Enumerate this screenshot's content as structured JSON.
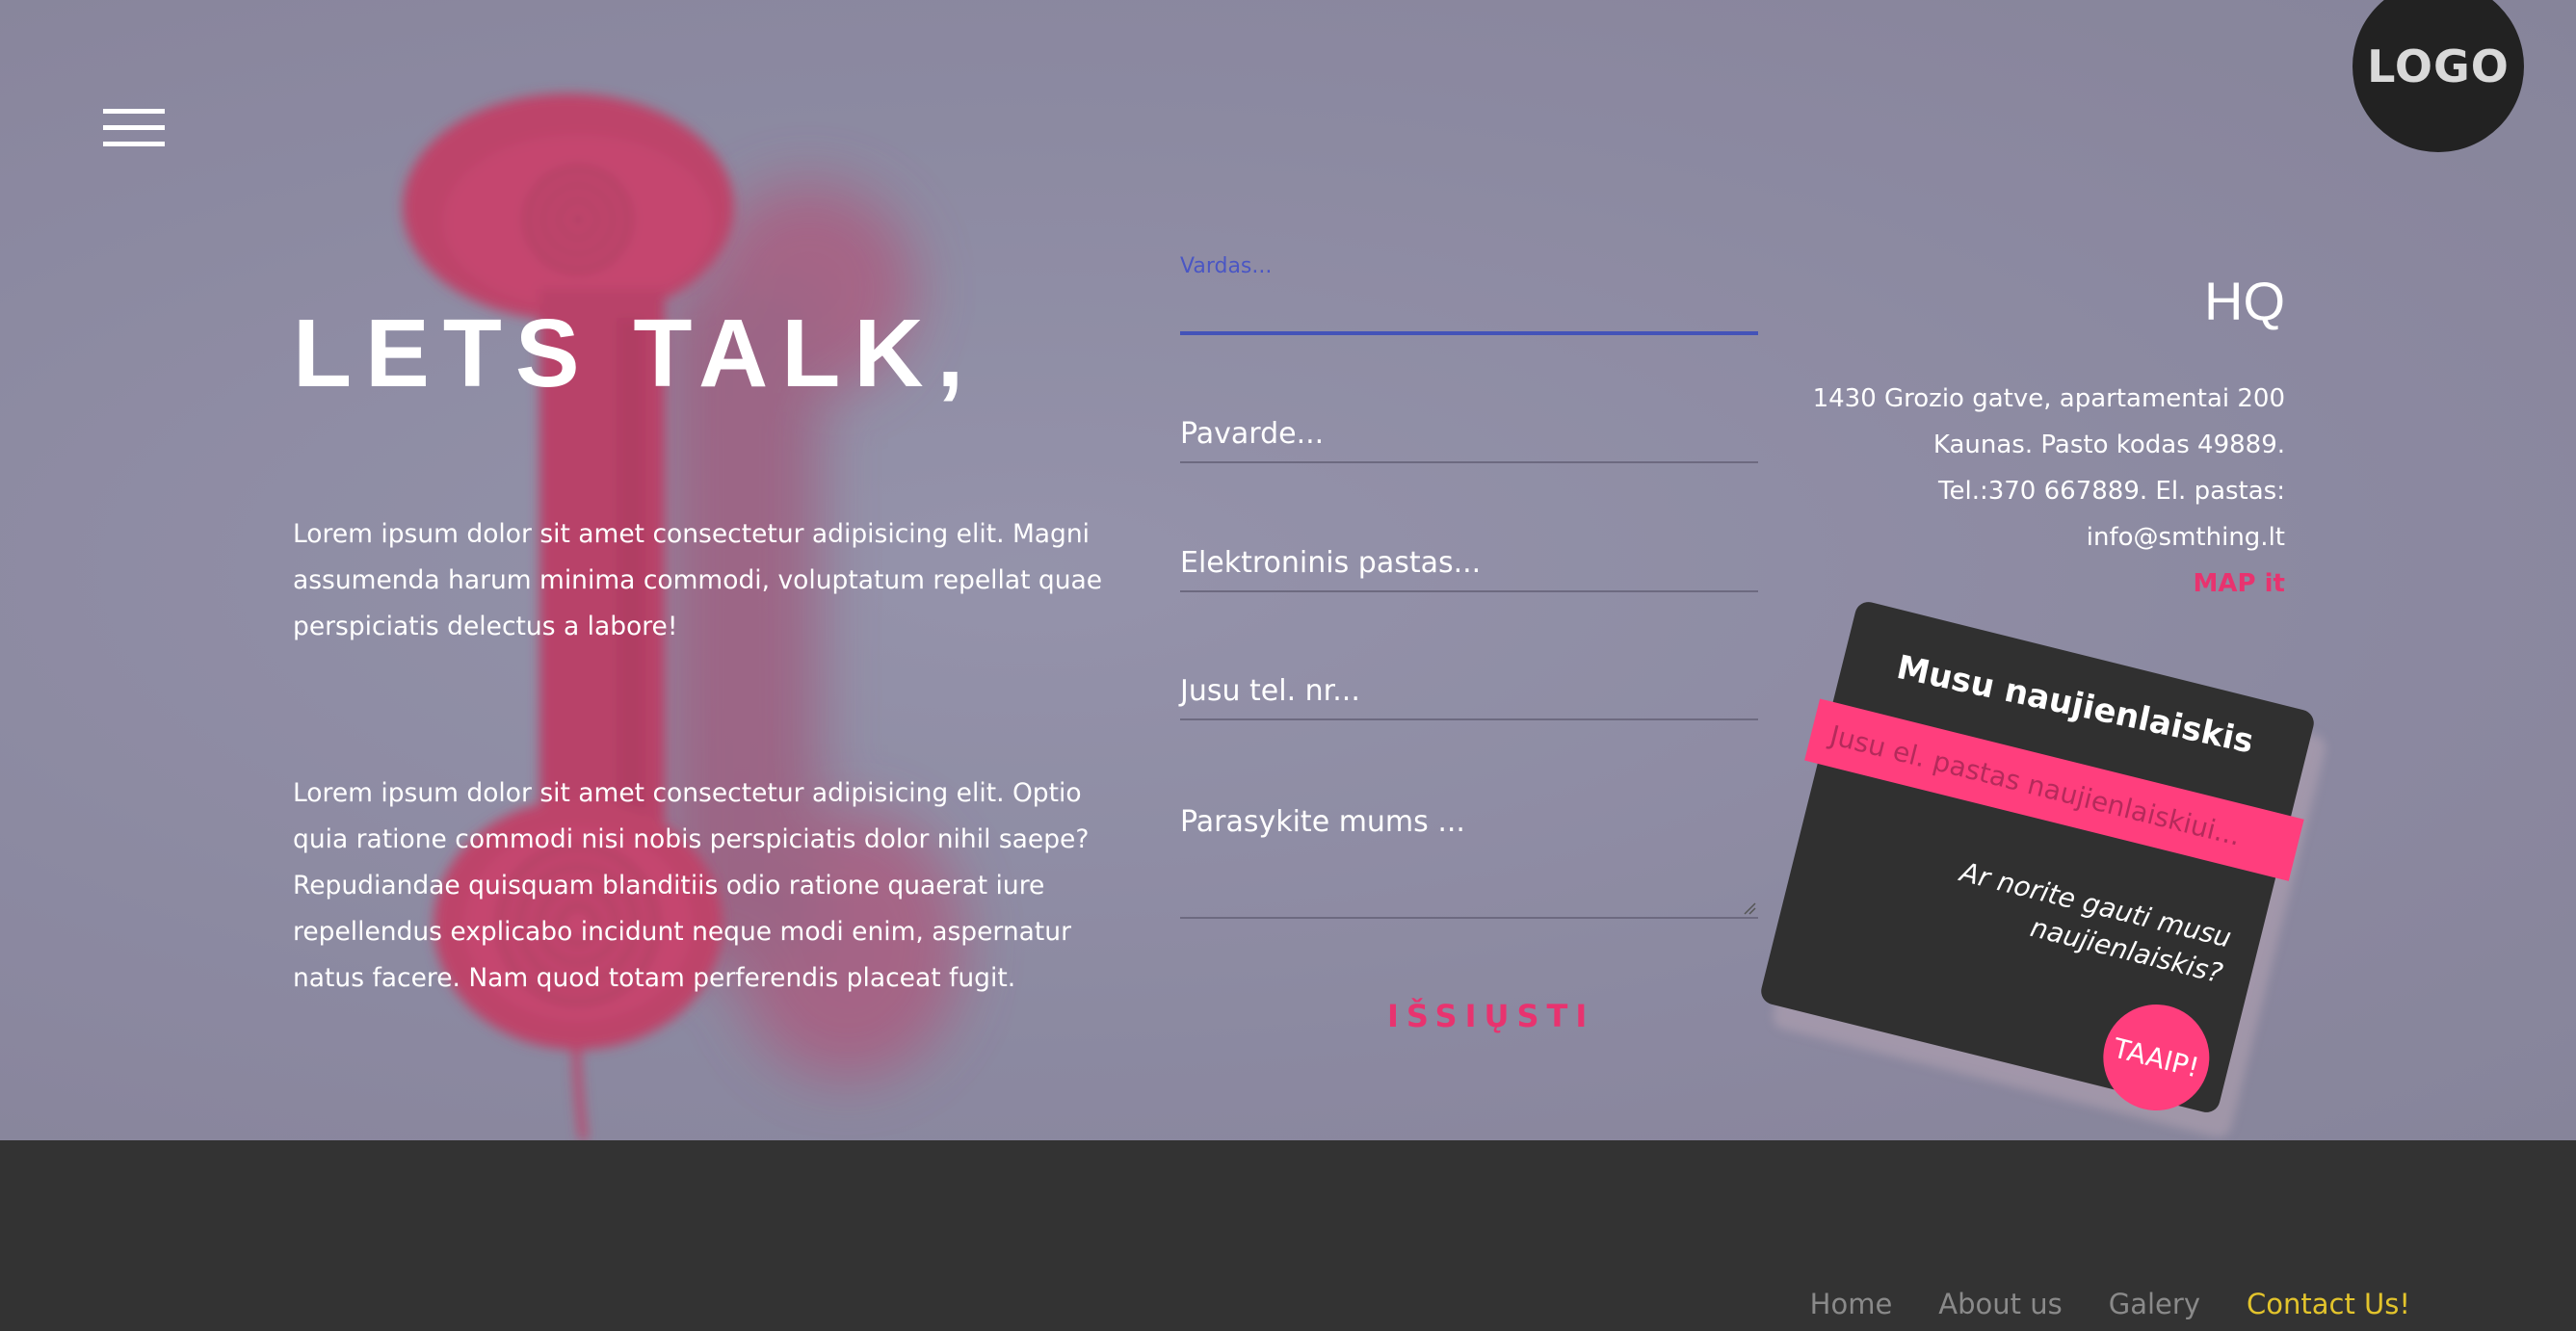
{
  "brand": {
    "logo_text": "LOGO"
  },
  "hero": {
    "title": "LETS TALK,",
    "paragraphs": [
      "Lorem ipsum dolor sit amet consectetur adipisicing elit. Magni assumenda harum minima commodi, voluptatum repellat quae perspiciatis delectus a labore!",
      "Lorem ipsum dolor sit amet consectetur adipisicing elit. Optio quia ratione commodi nisi nobis perspiciatis dolor nihil saepe? Repudiandae quisquam blanditiis odio ratione quaerat iure repellendus explicabo incidunt neque modi enim, aspernatur natus facere. Nam quod totam perferendis placeat fugit."
    ]
  },
  "form": {
    "name_placeholder": "Vardas...",
    "surname_placeholder": "Pavarde...",
    "email_placeholder": "Elektroninis pastas...",
    "phone_placeholder": "Jusu tel. nr...",
    "message_placeholder": "Parasykite mums ...",
    "submit_label": "IŠSIŲSTI"
  },
  "hq": {
    "title": "HQ",
    "lines": [
      "1430 Grozio gatve, apartamentai 200",
      "Kaunas. Pasto kodas 49889.",
      "Tel.:370 667889. El. pastas:",
      "info@smthing.lt"
    ],
    "map_label": "MAP it"
  },
  "newsletter": {
    "title": "Musu naujienlaiskis",
    "input_placeholder": "Jusu el. pastas naujienlaiskiui...",
    "question": "Ar norite gauti musu naujienlaiskis?",
    "button_label": "TAAIP!"
  },
  "footer": {
    "nav": [
      {
        "label": "Home",
        "active": false
      },
      {
        "label": "About us",
        "active": false
      },
      {
        "label": "Galery",
        "active": false
      },
      {
        "label": "Contact Us!",
        "active": true
      }
    ]
  },
  "colors": {
    "hero_bg": "#8f8ca4",
    "accent_pink": "#e8336f",
    "card_bg": "#303030",
    "footer_bg": "#333333",
    "active_nav": "#e3c42c",
    "focus_blue": "#4453b8"
  }
}
